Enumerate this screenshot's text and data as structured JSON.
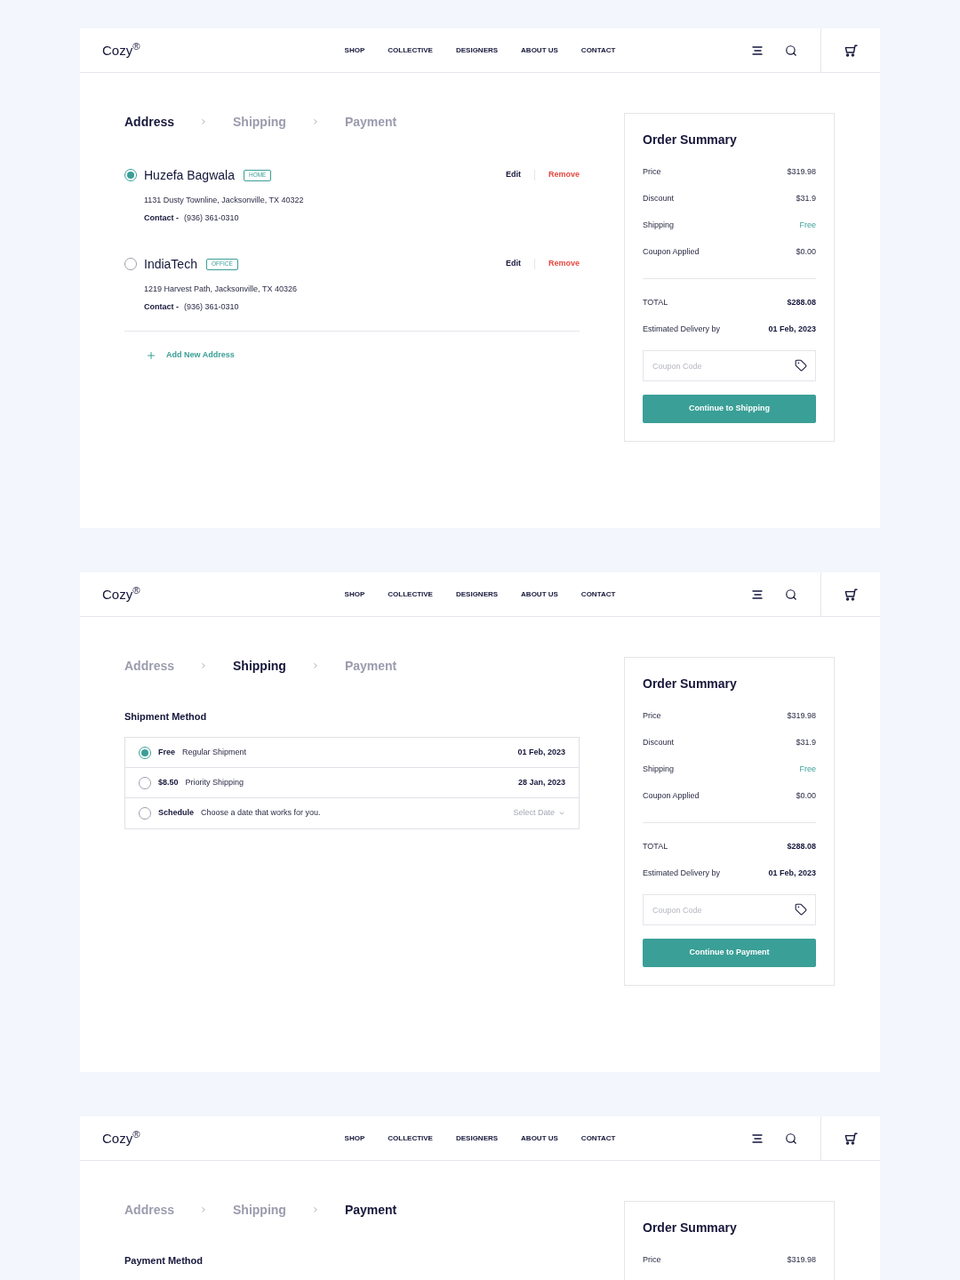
{
  "panels": [
    {
      "kind": "address",
      "header": {
        "logo": "Cozy$^{®}$",
        "nav": [
          "SHOP",
          "COLLECTIVE",
          "DESIGNERS",
          "ABOUT US",
          "CONTACT"
        ]
      },
      "steps": [
        {
          "label": "Address",
          "selected": true
        },
        {
          "label": "Shipping",
          "selected": false
        },
        {
          "label": "Payment",
          "selected": false
        }
      ],
      "addresses": [
        {
          "name": "Huzefa Bagwala",
          "tag": "HOME",
          "selected": true,
          "address": "1131 Dusty Townline, Jacksonville, TX 40322",
          "contact_label": "Contact -",
          "phone": "(936) 361-0310",
          "edit": "Edit",
          "remove": "Remove"
        },
        {
          "name": "IndiaTech",
          "tag": "OFFICE",
          "selected": false,
          "address": "1219 Harvest Path, Jacksonville, TX 40326",
          "contact_label": "Contact -",
          "phone": "(936) 361-0310",
          "edit": "Edit",
          "remove": "Remove"
        }
      ],
      "add_address": "Add New Address",
      "summary": {
        "title": "Order Summary",
        "rows": [
          {
            "label": "Price",
            "value": "$319.98",
            "kind": "plain"
          },
          {
            "label": "Discount",
            "value": "$31.9",
            "kind": "plain"
          },
          {
            "label": "Shipping",
            "value": "Free",
            "kind": "accent"
          },
          {
            "label": "Coupon Applied",
            "value": "$0.00",
            "kind": "plain"
          }
        ],
        "totals": [
          {
            "label": "TOTAL",
            "value": "$288.08"
          },
          {
            "label": "Estimated Delivery by",
            "value": "01 Feb, 2023"
          }
        ],
        "coupon": {
          "placeholder": "Coupon Code"
        },
        "button": "Continue to Shipping"
      }
    },
    {
      "kind": "shipping",
      "header": {
        "logo": "Cozy$^{®}$",
        "nav": [
          "SHOP",
          "COLLECTIVE",
          "DESIGNERS",
          "ABOUT US",
          "CONTACT"
        ]
      },
      "steps": [
        {
          "label": "Address",
          "selected": false
        },
        {
          "label": "Shipping",
          "selected": true
        },
        {
          "label": "Payment",
          "selected": false
        }
      ],
      "section_title": "Shipment Method",
      "options": [
        {
          "kind": "date",
          "price": "Free",
          "name": "Regular Shipment",
          "date": "01 Feb, 2023",
          "selected": true
        },
        {
          "kind": "date",
          "price": "$8.50",
          "name": "Priority Shipping",
          "date": "28 Jan, 2023",
          "selected": false
        },
        {
          "kind": "picker",
          "price": "Schedule",
          "name": "Choose a date that works for you.",
          "picker": "Select Date",
          "selected": false
        }
      ],
      "summary": {
        "title": "Order Summary",
        "rows": [
          {
            "label": "Price",
            "value": "$319.98",
            "kind": "plain"
          },
          {
            "label": "Discount",
            "value": "$31.9",
            "kind": "plain"
          },
          {
            "label": "Shipping",
            "value": "Free",
            "kind": "accent"
          },
          {
            "label": "Coupon Applied",
            "value": "$0.00",
            "kind": "plain"
          }
        ],
        "totals": [
          {
            "label": "TOTAL",
            "value": "$288.08"
          },
          {
            "label": "Estimated Delivery by",
            "value": "01 Feb, 2023"
          }
        ],
        "coupon": {
          "placeholder": "Coupon Code"
        },
        "button": "Continue to Payment"
      }
    },
    {
      "kind": "payment",
      "header": {
        "logo": "Cozy$^{®}$",
        "nav": [
          "SHOP",
          "COLLECTIVE",
          "DESIGNERS",
          "ABOUT US",
          "CONTACT"
        ]
      },
      "steps": [
        {
          "label": "Address",
          "selected": false
        },
        {
          "label": "Shipping",
          "selected": false
        },
        {
          "label": "Payment",
          "selected": true
        }
      ],
      "section_title": "Payment Method",
      "summary": {
        "title": "Order Summary",
        "rows": [
          {
            "label": "Price",
            "value": "$319.98",
            "kind": "plain"
          }
        ]
      }
    }
  ]
}
